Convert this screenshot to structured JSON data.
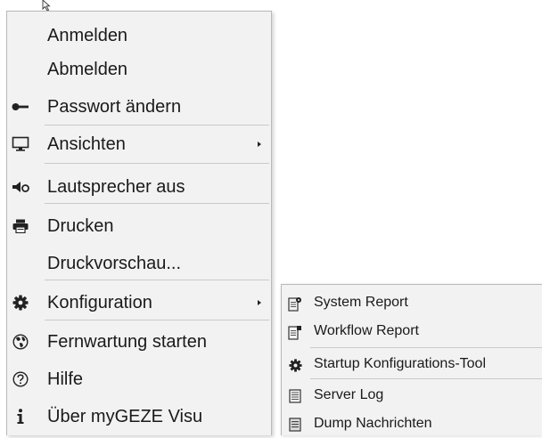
{
  "context_menu": {
    "items": [
      {
        "label": "Anmelden",
        "icon": "none"
      },
      {
        "label": "Abmelden",
        "icon": "none"
      },
      {
        "label": "Passwort ändern",
        "icon": "key-icon"
      },
      {
        "label": "Ansichten",
        "icon": "monitor-icon",
        "has_submenu": true
      },
      {
        "label": "Lautsprecher aus",
        "icon": "speaker-mute-icon"
      },
      {
        "label": "Drucken",
        "icon": "printer-icon"
      },
      {
        "label": "Druckvorschau...",
        "icon": "none"
      },
      {
        "label": "Konfiguration",
        "icon": "gear-icon",
        "has_submenu": true,
        "active": true
      },
      {
        "label": "Fernwartung starten",
        "icon": "globe-icon"
      },
      {
        "label": "Hilfe",
        "icon": "help-icon"
      },
      {
        "label": "Über myGEZE Visu",
        "icon": "info-icon"
      }
    ]
  },
  "submenu": {
    "parent": "Konfiguration",
    "items": [
      {
        "label": "System Report",
        "icon": "report-gear-icon"
      },
      {
        "label": "Workflow Report",
        "icon": "report-icon"
      },
      {
        "label": "Startup Konfigurations-Tool",
        "icon": "gear-icon"
      },
      {
        "label": "Server Log",
        "icon": "log-icon"
      },
      {
        "label": "Dump Nachrichten",
        "icon": "document-icon"
      }
    ]
  },
  "colors": {
    "menu_background": "#f2f2f2",
    "border": "#b9b9b9",
    "separator": "#c9c9c9",
    "text": "#1a1a1a"
  }
}
